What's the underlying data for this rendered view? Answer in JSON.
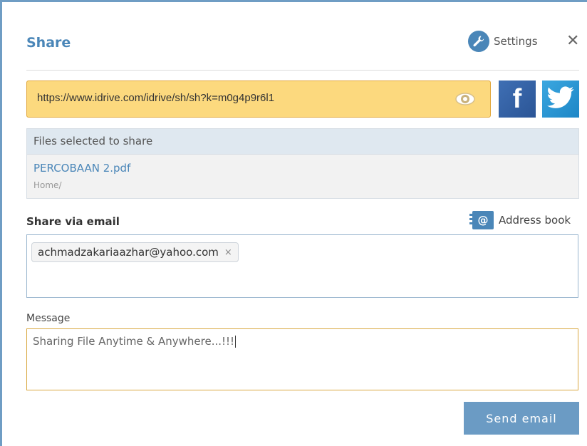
{
  "dialog": {
    "title": "Share",
    "settings_label": "Settings",
    "close_symbol": "✕"
  },
  "share_link": {
    "url": "https://www.idrive.com/idrive/sh/sh?k=m0g4p9r6l1"
  },
  "social": {
    "facebook_icon": "facebook-icon",
    "twitter_icon": "twitter-icon"
  },
  "files": {
    "header": "Files selected to share",
    "items": [
      {
        "name": "PERCOBAAN 2.pdf",
        "path": "Home/"
      }
    ]
  },
  "email": {
    "label": "Share via email",
    "address_book_label": "Address book",
    "recipients": [
      "achmadzakariaazhar@yahoo.com"
    ],
    "chip_remove_symbol": "×"
  },
  "message": {
    "label": "Message",
    "value": "Sharing File Anytime & Anywhere...!!!"
  },
  "actions": {
    "send_label": "Send email"
  },
  "colors": {
    "accent": "#4a86b8",
    "link_bg": "#fcd97e",
    "button": "#6b9bc4"
  }
}
